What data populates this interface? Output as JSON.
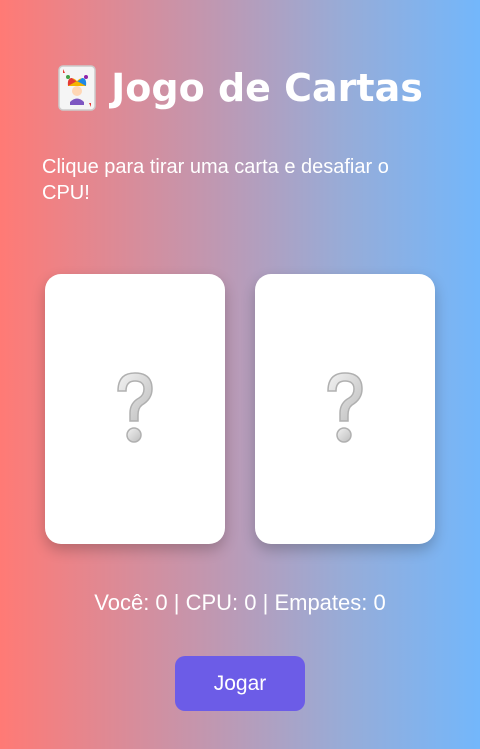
{
  "header": {
    "icon": "joker-card-icon",
    "title": "Jogo de Cartas"
  },
  "instructions": "Clique para tirar uma carta e desafiar o CPU!",
  "cards": {
    "player": {
      "symbol": "question-mark-icon"
    },
    "cpu": {
      "symbol": "question-mark-icon"
    }
  },
  "score": {
    "text": "Você: 0 | CPU: 0 | Empates: 0"
  },
  "actions": {
    "play_label": "Jogar"
  },
  "colors": {
    "gradient_start": "#ff7a75",
    "gradient_end": "#73b7fb",
    "button": "#6c5ce7",
    "card": "#ffffff"
  }
}
